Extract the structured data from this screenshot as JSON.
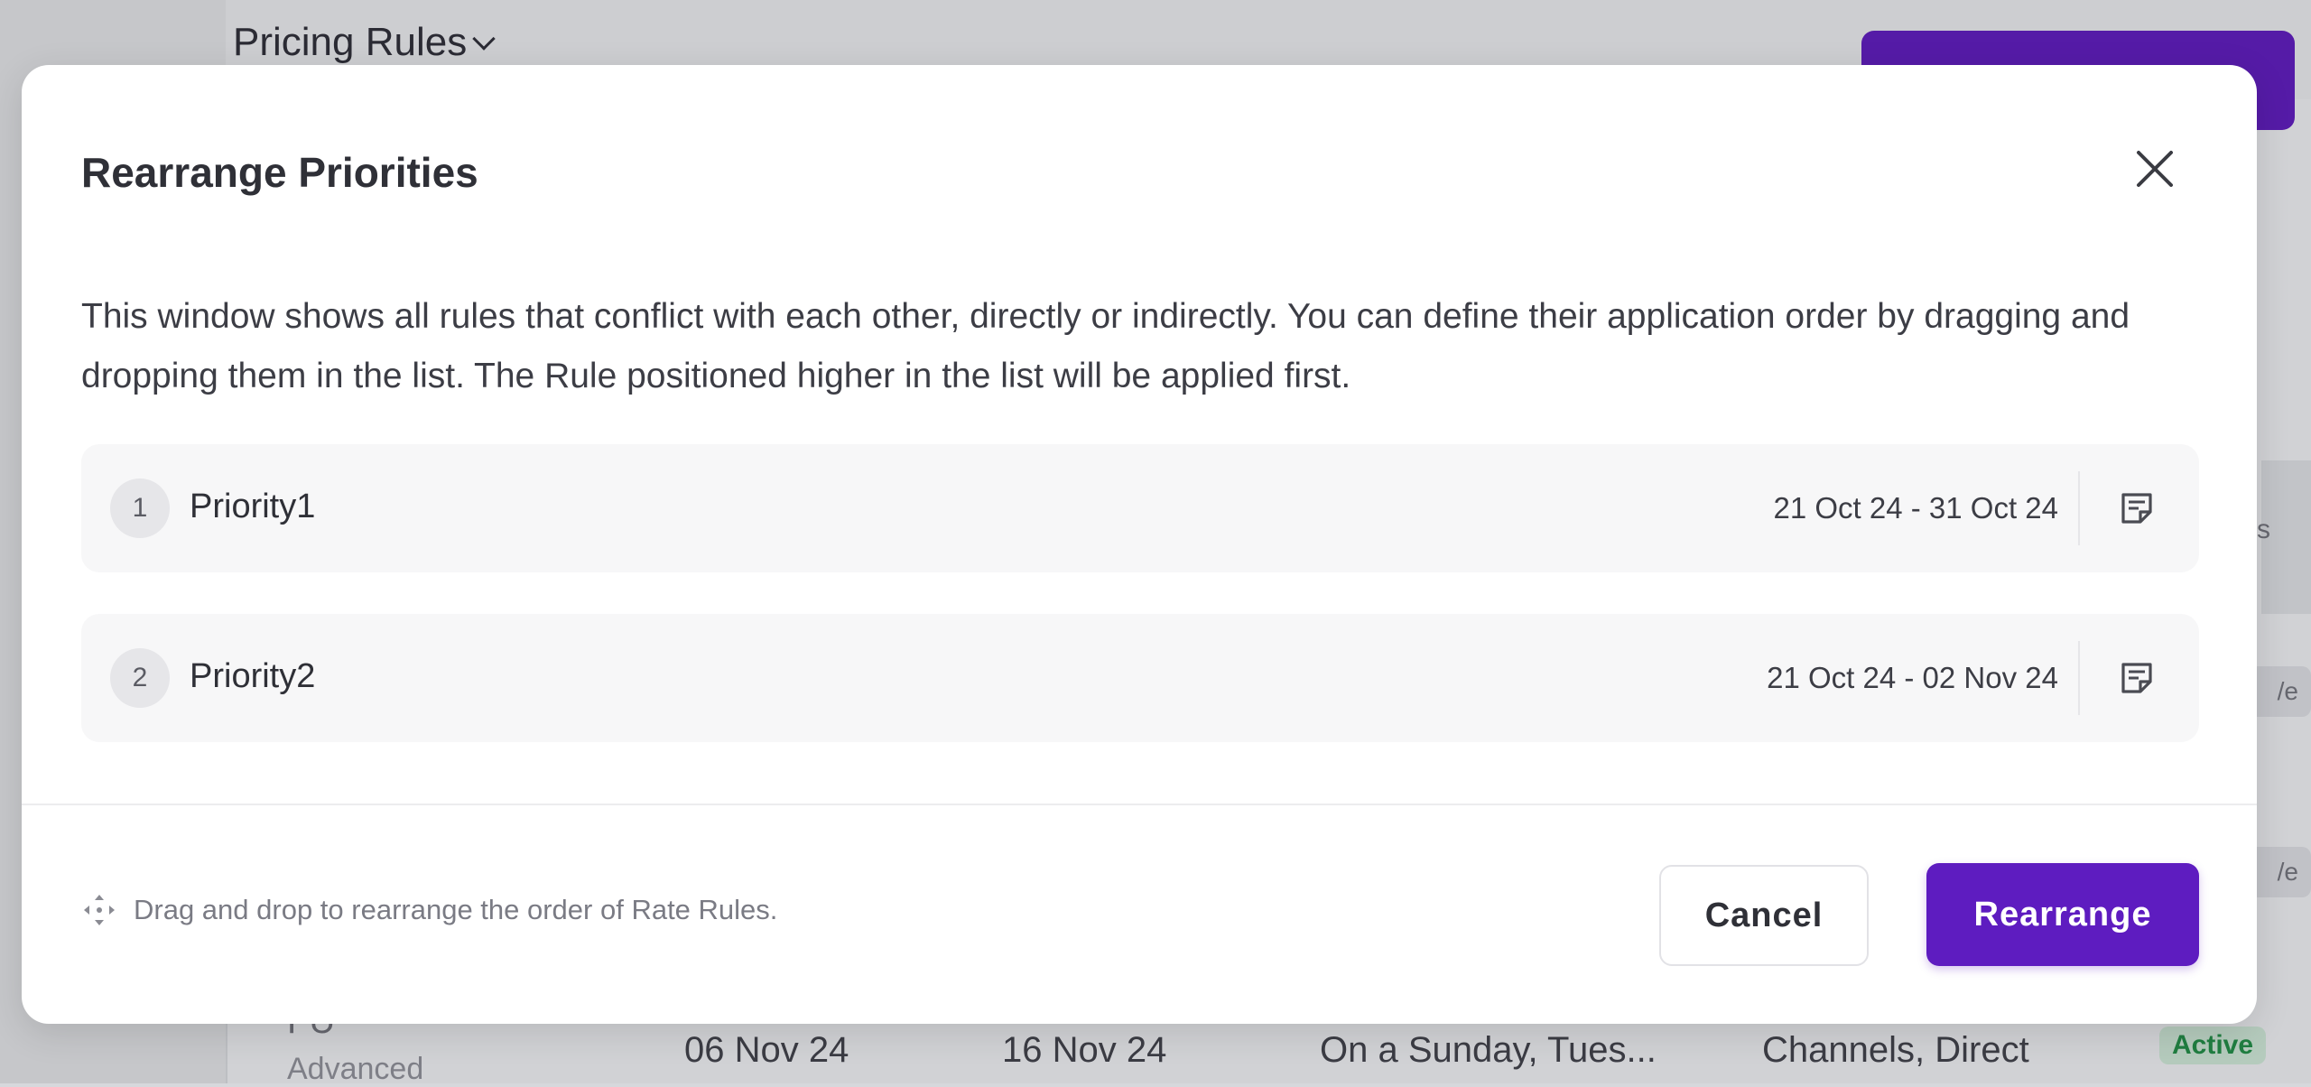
{
  "background": {
    "page_title": "Pricing Rules",
    "row": {
      "code": "FU",
      "type": "Advanced",
      "start_date": "06 Nov 24",
      "end_date": "16 Nov 24",
      "days": "On a Sunday, Tues...",
      "channels": "Channels, Direct",
      "status": "Active"
    },
    "right_header_fragment": "s",
    "pill_fragment_1": "/e",
    "pill_fragment_2": "/e"
  },
  "modal": {
    "title": "Rearrange Priorities",
    "description": "This window shows all rules that conflict with each other, directly or indirectly. You can define their application order by dragging and dropping them in the list. The Rule positioned higher in the list will be applied first.",
    "rules": [
      {
        "number": "1",
        "name": "Priority1",
        "dates": "21 Oct 24 - 31 Oct 24"
      },
      {
        "number": "2",
        "name": "Priority2",
        "dates": "21 Oct 24 - 02 Nov 24"
      }
    ],
    "hint": "Drag and drop to rearrange the order of Rate Rules.",
    "cancel_label": "Cancel",
    "rearrange_label": "Rearrange"
  },
  "colors": {
    "primary": "#5e1cc0",
    "active_badge_text": "#1f8a44",
    "active_badge_bg": "#c9e2d1"
  },
  "icons": {
    "close": "close-icon",
    "note": "note-icon",
    "drag": "drag-move-icon",
    "title_dropdown": "chevron-down-icon"
  }
}
